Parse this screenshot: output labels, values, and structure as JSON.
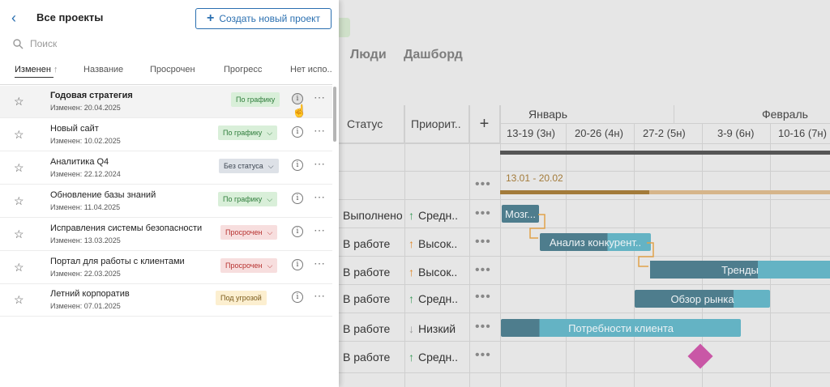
{
  "background": {
    "tabs": [
      "Люди",
      "Дашборд"
    ],
    "table": {
      "headers": {
        "status": "Статус",
        "priority": "Приорит..",
        "add": "+"
      },
      "months": [
        "Январь",
        "Февраль"
      ],
      "weeks": [
        "13-19 (3н)",
        "20-26 (4н)",
        "27-2 (5н)",
        "3-9 (6н)",
        "10-16 (7н)"
      ],
      "range_label": "13.01 - 20.02",
      "rows": [
        {
          "status": "Выполнено",
          "priority": "Средн..",
          "arrow": "↑",
          "arrow_color": "#3a9a5a"
        },
        {
          "status": "В работе",
          "priority": "Высок..",
          "arrow": "↑",
          "arrow_color": "#e08a2a"
        },
        {
          "status": "В работе",
          "priority": "Высок..",
          "arrow": "↑",
          "arrow_color": "#e08a2a"
        },
        {
          "status": "В работе",
          "priority": "Средн..",
          "arrow": "↑",
          "arrow_color": "#3a9a5a"
        },
        {
          "status": "В работе",
          "priority": "Низкий",
          "arrow": "↓",
          "arrow_color": "#9a9a9a"
        },
        {
          "status": "В работе",
          "priority": "Средн..",
          "arrow": "↑",
          "arrow_color": "#3a9a5a"
        }
      ],
      "bars": [
        "Мозг...",
        "Анализ конкурент..",
        "Тренды",
        "Обзор рынка",
        "Потребности клиента"
      ],
      "colors": {
        "bar_dark": "#4e7d8d",
        "bar_light": "#64b3c4",
        "milestone": "#c957a6",
        "range_dark": "#a37b3a",
        "range_light": "#d6b58a"
      }
    }
  },
  "panel": {
    "title": "Все проекты",
    "new_project_label": "Создать новый проект",
    "search_placeholder": "Поиск",
    "columns": [
      "Изменен",
      "Название",
      "Просрочен",
      "Прогресс",
      "Нет испо.."
    ],
    "sort_arrow": "↑",
    "projects": [
      {
        "name": "Годовая стратегия",
        "changed": "Изменен: 20.04.2025",
        "status": "По графику",
        "bg": "#d9efd9",
        "fg": "#2f7d3b",
        "chevron": false
      },
      {
        "name": "Новый сайт",
        "changed": "Изменен: 10.02.2025",
        "status": "По графику",
        "bg": "#d9efd9",
        "fg": "#2f7d3b",
        "chevron": true
      },
      {
        "name": "Аналитика Q4",
        "changed": "Изменен: 22.12.2024",
        "status": "Без статуса",
        "bg": "#dde1e7",
        "fg": "#3d4652",
        "chevron": true
      },
      {
        "name": "Обновление базы знаний",
        "changed": "Изменен: 11.04.2025",
        "status": "По графику",
        "bg": "#d9efd9",
        "fg": "#2f7d3b",
        "chevron": true
      },
      {
        "name": "Исправления системы безопасности",
        "changed": "Изменен: 13.03.2025",
        "status": "Просрочен",
        "bg": "#f7dede",
        "fg": "#b7312f",
        "chevron": true
      },
      {
        "name": "Портал для работы с клиентами",
        "changed": "Изменен: 22.03.2025",
        "status": "Просрочен",
        "bg": "#f7dede",
        "fg": "#b7312f",
        "chevron": true
      },
      {
        "name": "Летний корпоратив",
        "changed": "Изменен: 07.01.2025",
        "status": "Под угрозой",
        "bg": "#fcefd0",
        "fg": "#7a5a1a",
        "chevron": false
      }
    ]
  }
}
